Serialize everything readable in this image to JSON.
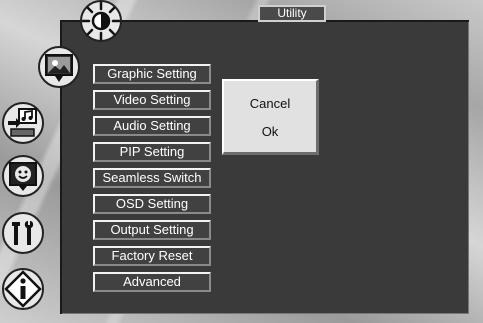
{
  "header": {
    "title": "Utility"
  },
  "sidebar": {
    "icons": [
      {
        "name": "brightness-icon"
      },
      {
        "name": "picture-icon"
      },
      {
        "name": "audio-input-icon"
      },
      {
        "name": "face-icon"
      },
      {
        "name": "tools-icon"
      },
      {
        "name": "info-icon"
      }
    ]
  },
  "menu": {
    "items": [
      "Graphic Setting",
      "Video Setting",
      "Audio Setting",
      "PIP Setting",
      "Seamless Switch",
      "OSD Setting",
      "Output Setting",
      "Factory Reset",
      "Advanced"
    ]
  },
  "popup": {
    "options": [
      "Cancel",
      "Ok"
    ]
  },
  "colors": {
    "panel": "#3a3a3a",
    "menu_bg": "#414141",
    "popup_bg": "#e1e1e1",
    "text_light": "#ffffff"
  }
}
